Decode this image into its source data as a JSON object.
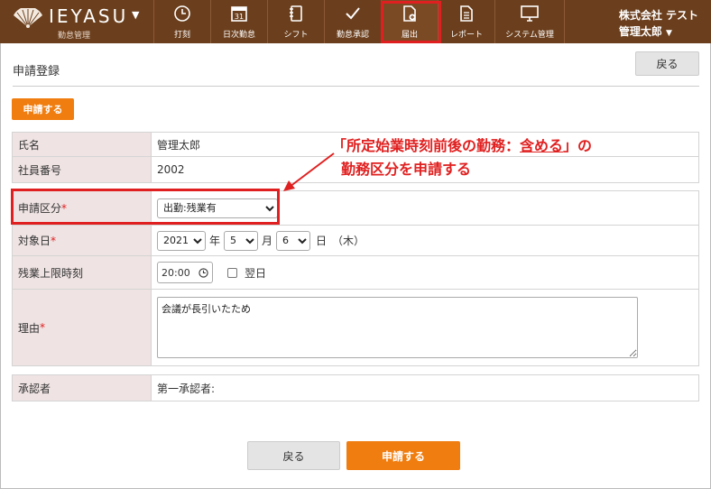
{
  "app": {
    "name": "IEYASU",
    "caret": "▼",
    "subtitle": "勤怠管理"
  },
  "nav": [
    {
      "label": "打刻",
      "icon": "clock-icon"
    },
    {
      "label": "日次勤怠",
      "icon": "calendar-icon",
      "icon_text": "31"
    },
    {
      "label": "シフト",
      "icon": "notebook-icon"
    },
    {
      "label": "勤怠承認",
      "icon": "checkmark-icon"
    },
    {
      "label": "届出",
      "icon": "document-add-icon",
      "active": true
    },
    {
      "label": "レポート",
      "icon": "report-icon"
    },
    {
      "label": "システム管理",
      "icon": "monitor-icon"
    }
  ],
  "user": {
    "company": "株式会社 テスト",
    "name": "管理太郎",
    "caret": "▼"
  },
  "page": {
    "title": "申請登録",
    "back_label": "戻る",
    "apply_label": "申請する"
  },
  "form": {
    "name_label": "氏名",
    "name_value": "管理太郎",
    "employee_no_label": "社員番号",
    "employee_no_value": "2002",
    "category_label": "申請区分",
    "category_value": "出勤:残業有",
    "date_label": "対象日",
    "year": "2021",
    "year_unit": "年",
    "month": "5",
    "month_unit": "月",
    "day": "6",
    "day_unit": "日",
    "weekday": "（木）",
    "overtime_label": "残業上限時刻",
    "overtime_time": "20:00",
    "next_day_label": "翌日",
    "reason_label": "理由",
    "reason_value": "会議が長引いたため",
    "approver_label": "承認者",
    "approver_value": "第一承認者:",
    "required_mark": "*"
  },
  "annotation": {
    "line1_prefix": "「所定始業時刻前後の勤務：",
    "line1_emphasis": "含める",
    "line1_suffix": "」の",
    "line2": "勤務区分を申請する"
  },
  "colors": {
    "nav_bg": "#6b3f1d",
    "accent": "#f07d0f",
    "label_bg": "#efe3e3",
    "highlight": "#e02020"
  }
}
